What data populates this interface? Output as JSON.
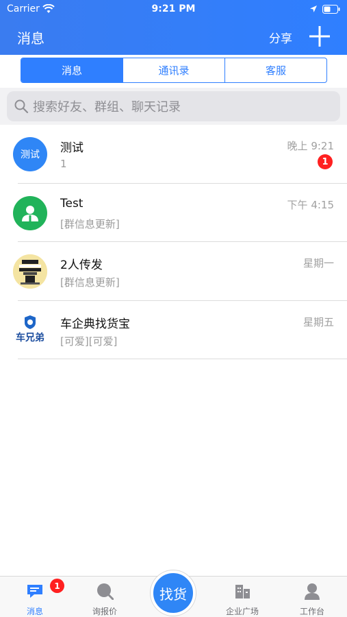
{
  "status_bar": {
    "carrier": "Carrier",
    "time": "9:21 PM"
  },
  "nav": {
    "title": "消息",
    "share_label": "分享"
  },
  "segments": [
    {
      "label": "消息",
      "active": true
    },
    {
      "label": "通讯录",
      "active": false
    },
    {
      "label": "客服",
      "active": false
    }
  ],
  "search": {
    "placeholder": "搜索好友、群组、聊天记录"
  },
  "chats": [
    {
      "avatar_text": "测试",
      "name": "测试",
      "preview": "1",
      "time": "晚上 9:21",
      "unread": "1"
    },
    {
      "name": "Test",
      "preview": "[群信息更新]",
      "time": "下午 4:15"
    },
    {
      "name": "2人传发",
      "preview": "[群信息更新]",
      "time": "星期一"
    },
    {
      "name": "车企典找货宝",
      "preview": "[可爱][可爱]",
      "time": "星期五",
      "logo_text": "车兄弟"
    }
  ],
  "tab_bar": {
    "tabs": [
      {
        "label": "消息",
        "icon": "message-icon",
        "active": true,
        "badge": "1"
      },
      {
        "label": "询报价",
        "icon": "inquiry-icon",
        "active": false
      },
      {
        "label": "企业广场",
        "icon": "building-icon",
        "active": false
      },
      {
        "label": "工作台",
        "icon": "person-icon",
        "active": false
      }
    ],
    "center_button": "找货"
  },
  "colors": {
    "primary": "#2f7fff",
    "badge": "#ff2020",
    "group_avatar": "#21b35a"
  }
}
